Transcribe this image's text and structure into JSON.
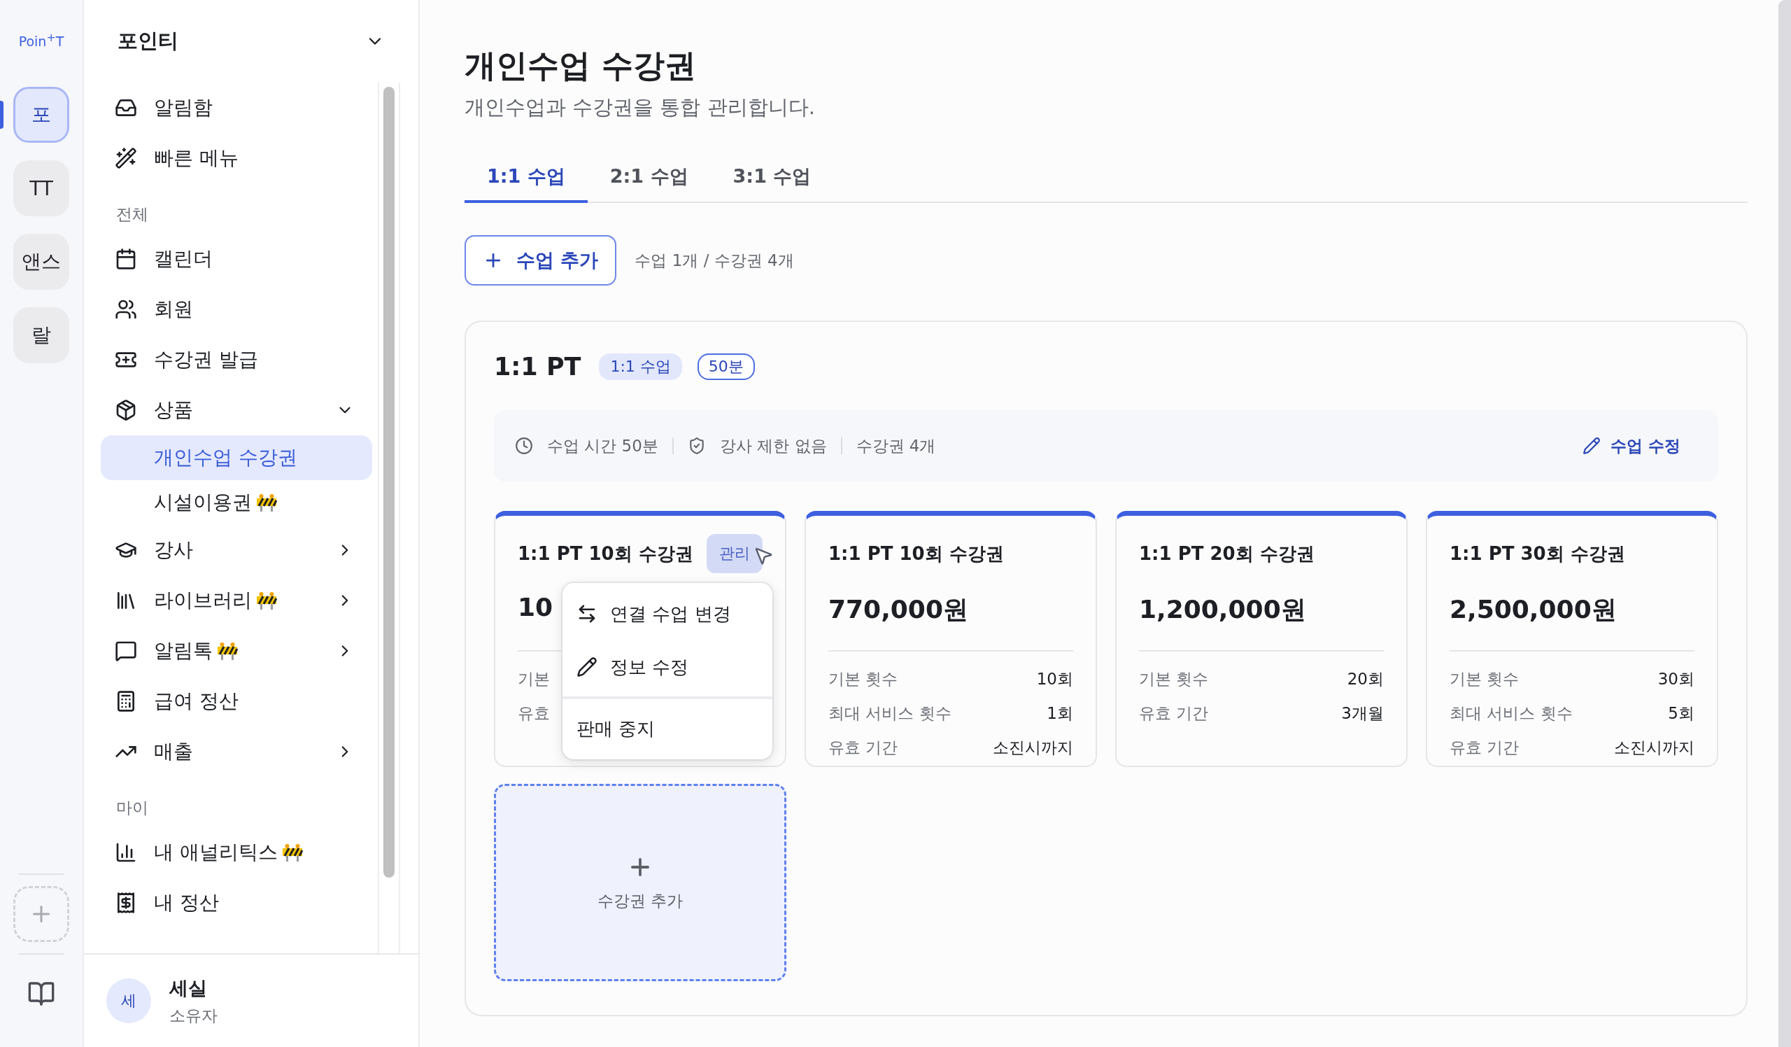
{
  "rail": {
    "logo": "Poin$^{+}$T",
    "workspaces": [
      {
        "label": "포",
        "selected": true
      },
      {
        "label": "TT",
        "selected": false
      },
      {
        "label": "앤스",
        "selected": false
      },
      {
        "label": "랄",
        "selected": false
      }
    ]
  },
  "sidebar": {
    "title": "포인티",
    "items": [
      {
        "kind": "item",
        "label": "알림함",
        "wip": false
      },
      {
        "kind": "item",
        "label": "빠른 메뉴",
        "wip": false
      },
      {
        "kind": "section",
        "label": "전체"
      },
      {
        "kind": "item",
        "label": "캘린더",
        "wip": false
      },
      {
        "kind": "item",
        "label": "회원",
        "wip": false
      },
      {
        "kind": "item",
        "label": "수강권 발급",
        "wip": false
      },
      {
        "kind": "item",
        "label": "상품",
        "wip": false,
        "expanded": true,
        "children": [
          {
            "label": "개인수업 수강권",
            "selected": true,
            "wip": false
          },
          {
            "label": "시설이용권",
            "selected": false,
            "wip": true
          }
        ]
      },
      {
        "kind": "item",
        "label": "강사",
        "wip": false,
        "expanded": false
      },
      {
        "kind": "item",
        "label": "라이브러리",
        "wip": true,
        "expanded": false
      },
      {
        "kind": "item",
        "label": "알림톡",
        "wip": true,
        "expanded": false
      },
      {
        "kind": "item",
        "label": "급여 정산",
        "wip": false
      },
      {
        "kind": "item",
        "label": "매출",
        "wip": false,
        "expanded": false
      },
      {
        "kind": "section",
        "label": "마이"
      },
      {
        "kind": "item",
        "label": "내 애널리틱스",
        "wip": true
      },
      {
        "kind": "item",
        "label": "내 정산",
        "wip": false
      }
    ],
    "user": {
      "avatar": "세",
      "name": "세실",
      "role": "소유자"
    }
  },
  "page": {
    "title": "개인수업 수강권",
    "subtitle": "개인수업과 수강권을 통합 관리합니다."
  },
  "tabs": [
    {
      "label": "1:1 수업",
      "selected": true
    },
    {
      "label": "2:1 수업",
      "selected": false
    },
    {
      "label": "3:1 수업",
      "selected": false
    }
  ],
  "add_button": "수업 추가",
  "summary": "수업 1개 / 수강권 4개",
  "course": {
    "name": "1:1 PT",
    "badges": [
      {
        "kind": "filled",
        "label": "1:1 수업"
      },
      {
        "kind": "outline",
        "label": "50분"
      }
    ],
    "info": [
      "수업 시간 50분",
      "강사 제한 없음",
      "수강권 4개"
    ],
    "edit_button": "수업 수정",
    "tickets": [
      {
        "title": "1:1 PT 10회 수강권",
        "price": "10",
        "rows": [
          {
            "label": "기본"
          },
          {
            "label": "유효"
          }
        ],
        "manage_button": "관리",
        "menu": [
          {
            "kind": "icon",
            "label": "연결 수업 변경"
          },
          {
            "kind": "icon",
            "label": "정보 수정"
          },
          {
            "kind": "plain",
            "label": "판매 중지"
          }
        ]
      },
      {
        "title": "1:1 PT 10회 수강권",
        "price": "770,000원",
        "rows": [
          {
            "label": "기본 횟수",
            "value": "10회"
          },
          {
            "label": "최대 서비스 횟수",
            "value": "1회"
          },
          {
            "label": "유효 기간",
            "value": "소진시까지"
          }
        ]
      },
      {
        "title": "1:1 PT 20회 수강권",
        "price": "1,200,000원",
        "rows": [
          {
            "label": "기본 횟수",
            "value": "20회"
          },
          {
            "label": "유효 기간",
            "value": "3개월"
          }
        ]
      },
      {
        "title": "1:1 PT 30회 수강권",
        "price": "2,500,000원",
        "rows": [
          {
            "label": "기본 횟수",
            "value": "30회"
          },
          {
            "label": "최대 서비스 횟수",
            "value": "5회"
          },
          {
            "label": "유효 기간",
            "value": "소진시까지"
          }
        ]
      }
    ],
    "add_ticket": "수강권 추가"
  }
}
